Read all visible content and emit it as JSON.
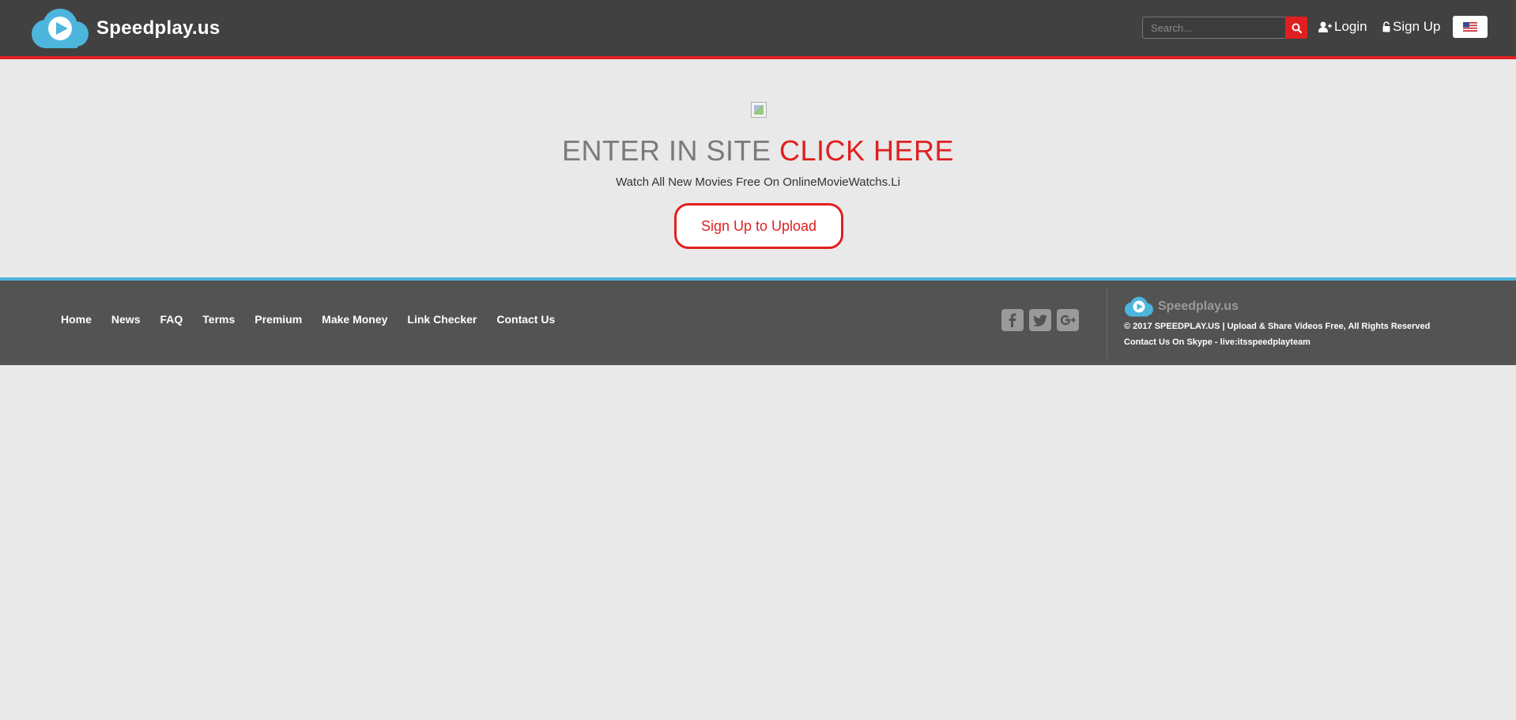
{
  "header": {
    "logo_text": "Speedplay.us",
    "search_placeholder": "Search...",
    "login_label": "Login",
    "signup_label": "Sign Up"
  },
  "main": {
    "enter_prefix": "ENTER IN SITE",
    "enter_link": "CLICK HERE",
    "subtitle": "Watch All New Movies Free On OnlineMovieWatchs.Li",
    "upload_button": "Sign Up to Upload"
  },
  "footer": {
    "nav": [
      "Home",
      "News",
      "FAQ",
      "Terms",
      "Premium",
      "Make Money",
      "Link Checker",
      "Contact Us"
    ],
    "brand_text": "Speedplay.us",
    "copyright": "© 2017 SPEEDPLAY.US | Upload & Share Videos Free, All Rights Reserved",
    "skype": "Contact Us On Skype - live:itsspeedplayteam"
  },
  "colors": {
    "header_bg": "#414141",
    "accent_red": "#e02020",
    "accent_blue": "#4cb6dd",
    "page_bg": "#e9e9e9",
    "footer_bg": "#535353"
  },
  "icons": {
    "search": "search-icon",
    "login": "user-plus-icon",
    "signup": "lock-icon",
    "language": "us-flag-icon",
    "social": [
      "facebook-icon",
      "twitter-icon",
      "google-plus-icon"
    ]
  }
}
